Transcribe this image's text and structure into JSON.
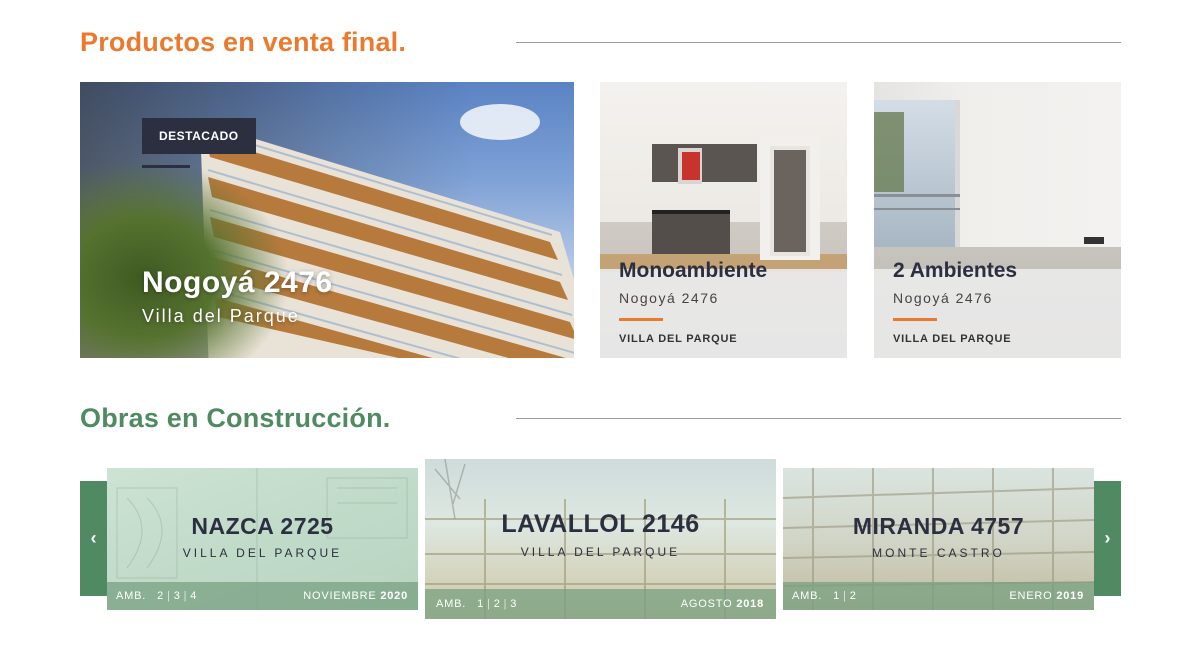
{
  "sections": {
    "sale_title": "Productos en venta final.",
    "construction_title": "Obras en Construcción."
  },
  "featured": {
    "badge": "DESTACADO",
    "title": "Nogoyá 2476",
    "subtitle": "Villa del Parque"
  },
  "products": [
    {
      "title": "Monoambiente",
      "address": "Nogoyá 2476",
      "zone": "VILLA DEL PARQUE"
    },
    {
      "title": "2 Ambientes",
      "address": "Nogoyá 2476",
      "zone": "VILLA DEL PARQUE"
    }
  ],
  "carousel": {
    "prev_icon": "‹",
    "next_icon": "›",
    "items": [
      {
        "title": "NAZCA 2725",
        "zone": "VILLA DEL PARQUE",
        "amb_label": "AMB.",
        "amb": [
          "2",
          "3",
          "4"
        ],
        "month": "NOVIEMBRE",
        "year": "2020"
      },
      {
        "title": "LAVALLOL 2146",
        "zone": "VILLA DEL PARQUE",
        "amb_label": "AMB.",
        "amb": [
          "1",
          "2",
          "3"
        ],
        "month": "AGOSTO",
        "year": "2018"
      },
      {
        "title": "MIRANDA 4757",
        "zone": "MONTE CASTRO",
        "amb_label": "AMB.",
        "amb": [
          "1",
          "2"
        ],
        "month": "ENERO",
        "year": "2019"
      }
    ]
  },
  "colors": {
    "accent_orange": "#ec7a2e",
    "accent_green": "#4f8a62",
    "dark": "#2b2f3f"
  }
}
